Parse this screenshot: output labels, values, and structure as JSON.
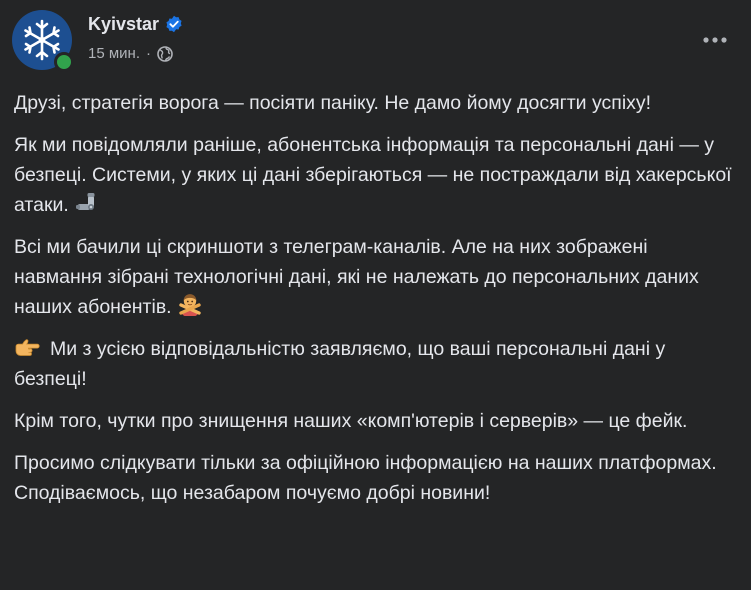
{
  "post": {
    "author": "Kyivstar",
    "time": "15 мин.",
    "separator": "·",
    "icons": {
      "avatar": "snowflake-logo-icon",
      "verified": "verified-badge-icon",
      "audience": "globe-icon",
      "more": "more-options-icon"
    },
    "colors": {
      "background": "#242526",
      "text": "#e4e6eb",
      "secondary_text": "#b0b3b8",
      "verified": "#1b74e4",
      "online": "#31a24c",
      "avatar_bg": "#1d4f91"
    },
    "paragraphs": [
      {
        "text": "Друзі, стратегія ворога — посіяти паніку. Не дамо йому досягти успіху!"
      },
      {
        "text": "Як ми повідомляли раніше, абонентська інформація та персональні дані — у безпеці. Системи, у яких ці дані зберігаються — не постраждали від хакерської атаки.",
        "emoji_after": "mechanical-arm-icon"
      },
      {
        "text": "Всі ми бачили ці скриншоти з телеграм-каналів. Але на них зображені навмання зібрані технологічні дані, які не належать до персональних даних наших абонентів.",
        "emoji_after": "person-gesturing-no-icon"
      },
      {
        "text": "Ми з усією відповідальністю заявляємо, що ваші персональні дані у безпеці!",
        "emoji_before": "pointing-right-icon"
      },
      {
        "text": "Крім того, чутки про знищення наших «комп'ютерів і серверів» — це фейк."
      },
      {
        "text": "Просимо слідкувати тільки за офіційною інформацією на наших платформах. Сподіваємось, що незабаром почуємо добрі новини!"
      }
    ]
  }
}
